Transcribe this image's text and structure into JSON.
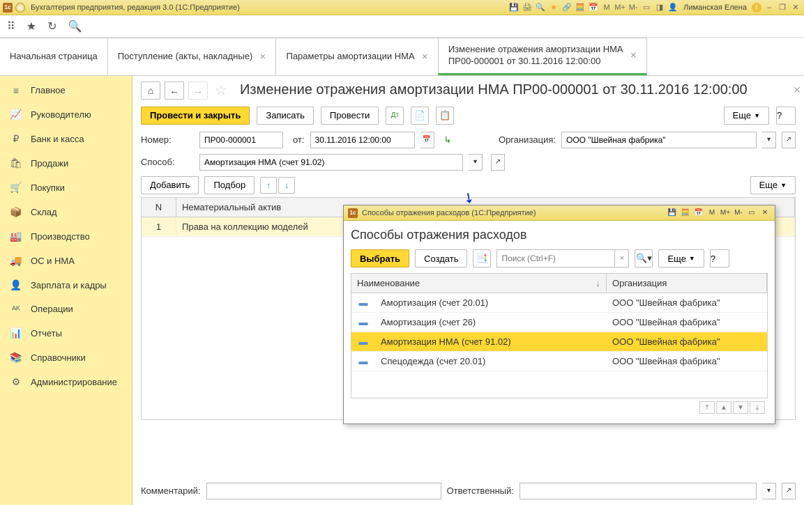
{
  "titlebar": {
    "app_title": "Бухгалтерия предприятия, редакция 3.0  (1С:Предприятие)",
    "user": "Лиманская Елена",
    "m_labels": [
      "M",
      "M+",
      "M-"
    ]
  },
  "tabs": [
    {
      "label": "Начальная страница",
      "closable": false
    },
    {
      "label": "Поступление (акты, накладные)",
      "closable": true
    },
    {
      "label": "Параметры амортизации НМА",
      "closable": true
    },
    {
      "label": "Изменение отражения амортизации НМА ПР00-000001 от 30.11.2016 12:00:00",
      "closable": true,
      "active": true
    }
  ],
  "sidebar": [
    {
      "icon": "≡",
      "label": "Главное"
    },
    {
      "icon": "📈",
      "label": "Руководителю"
    },
    {
      "icon": "₽",
      "label": "Банк и касса"
    },
    {
      "icon": "🛍",
      "label": "Продажи"
    },
    {
      "icon": "🛒",
      "label": "Покупки"
    },
    {
      "icon": "📦",
      "label": "Склад"
    },
    {
      "icon": "🏭",
      "label": "Производство"
    },
    {
      "icon": "🚚",
      "label": "ОС и НМА"
    },
    {
      "icon": "👤",
      "label": "Зарплата и кадры"
    },
    {
      "icon": "ᴬᴷ",
      "label": "Операции"
    },
    {
      "icon": "📊",
      "label": "Отчеты"
    },
    {
      "icon": "📚",
      "label": "Справочники"
    },
    {
      "icon": "⚙",
      "label": "Администрирование"
    }
  ],
  "doc": {
    "title": "Изменение отражения амортизации НМА ПР00-000001 от 30.11.2016 12:00:00",
    "btn_post_close": "Провести и закрыть",
    "btn_save": "Записать",
    "btn_post": "Провести",
    "btn_more": "Еще",
    "btn_help": "?",
    "number_label": "Номер:",
    "number_value": "ПР00-000001",
    "date_prefix": "от:",
    "date_value": "30.11.2016 12:00:00",
    "org_label": "Организация:",
    "org_value": "ООО \"Швейная фабрика\"",
    "method_label": "Способ:",
    "method_value": "Амортизация НМА (счет 91.02)",
    "btn_add": "Добавить",
    "btn_pick": "Подбор",
    "grid_header_n": "N",
    "grid_header_asset": "Нематериальный актив",
    "grid_rows": [
      {
        "n": "1",
        "name": "Права на коллекцию моделей"
      }
    ],
    "comment_label": "Комментарий:",
    "responsible_label": "Ответственный:"
  },
  "modal": {
    "window_title": "Способы отражения расходов  (1С:Предприятие)",
    "heading": "Способы отражения расходов",
    "btn_select": "Выбрать",
    "btn_create": "Создать",
    "search_placeholder": "Поиск (Ctrl+F)",
    "btn_more": "Еще",
    "btn_help": "?",
    "col_name": "Наименование",
    "col_org": "Организация",
    "m_labels": [
      "M",
      "M+",
      "M-"
    ],
    "rows": [
      {
        "name": "Амортизация (счет 20.01)",
        "org": "ООО \"Швейная фабрика\""
      },
      {
        "name": "Амортизация (счет 26)",
        "org": "ООО \"Швейная фабрика\""
      },
      {
        "name": "Амортизация НМА (счет 91.02)",
        "org": "ООО \"Швейная фабрика\"",
        "selected": true
      },
      {
        "name": "Спецодежда (счет 20.01)",
        "org": "ООО \"Швейная фабрика\""
      }
    ]
  }
}
